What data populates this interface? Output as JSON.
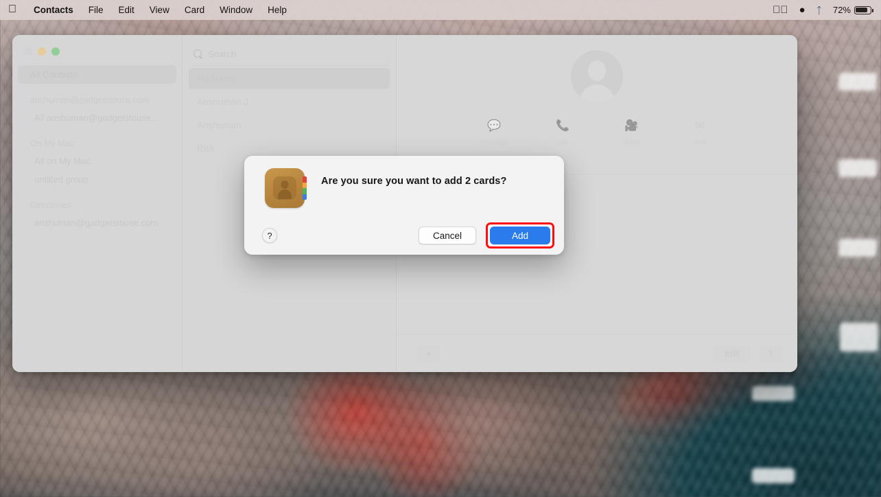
{
  "menubar": {
    "apple_icon": "apple-logo-icon",
    "items": [
      {
        "label": "Contacts",
        "bold": true
      },
      {
        "label": "File"
      },
      {
        "label": "Edit"
      },
      {
        "label": "View"
      },
      {
        "label": "Card"
      },
      {
        "label": "Window"
      },
      {
        "label": "Help"
      }
    ],
    "status": {
      "control_center_icon": "play-circle-icon",
      "app_icon": "dark-app-icon",
      "bluetooth_icon": "bluetooth-icon",
      "battery_percent": "72%",
      "battery_level": 72
    }
  },
  "window": {
    "traffic_lights": {
      "close": "close-button",
      "minimize": "minimize-button",
      "zoom": "zoom-button"
    },
    "sidebar": {
      "all_contacts": "All Contacts",
      "groups": [
        {
          "header": "anshuman@gadgetstouse.com",
          "items": [
            "All anshuman@gadgetstouse,.."
          ]
        },
        {
          "header": "On My Mac",
          "items": [
            "All on My Mac",
            "untitled group"
          ]
        },
        {
          "header": "Directories",
          "items": [
            "anshuman@gadgetstouse.com"
          ]
        }
      ]
    },
    "list": {
      "search_placeholder": "Search",
      "search_value": "",
      "search_icon": "search-icon",
      "contacts": [
        {
          "name": "No Name",
          "selected": true
        },
        {
          "name": "Anshuman J",
          "selected": false
        },
        {
          "name": "Anshuman",
          "selected": false
        },
        {
          "name": "Ritik",
          "selected": false
        }
      ]
    },
    "detail": {
      "avatar_icon": "person-placeholder-avatar",
      "actions": [
        {
          "label": "message",
          "icon": "message-bubble-icon",
          "glyph": "●"
        },
        {
          "label": "call",
          "icon": "phone-icon",
          "glyph": "✆"
        },
        {
          "label": "video",
          "icon": "video-camera-icon",
          "glyph": "▬"
        },
        {
          "label": "mail",
          "icon": "mail-envelope-icon",
          "glyph": "✉"
        }
      ],
      "bottom": {
        "add_label": "+",
        "edit_label": "Edit",
        "share_icon": "share-icon",
        "share_glyph": "⇧"
      }
    }
  },
  "dialog": {
    "app_icon": "contacts-app-icon",
    "title": "Are you sure you want to add 2 cards?",
    "help_label": "?",
    "cancel_label": "Cancel",
    "add_label": "Add",
    "highlight_color": "#ff0d0d",
    "primary_color": "#2a7bec"
  }
}
